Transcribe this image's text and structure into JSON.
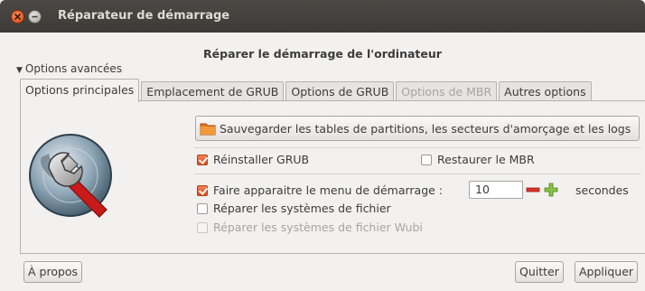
{
  "window": {
    "title": "Réparateur de démarrage"
  },
  "heading": "Réparer le démarrage de l'ordinateur",
  "expander": {
    "label": "Options avancées"
  },
  "tabs": [
    {
      "label": "Options principales",
      "state": "active"
    },
    {
      "label": "Emplacement de GRUB",
      "state": "normal"
    },
    {
      "label": "Options de GRUB",
      "state": "normal"
    },
    {
      "label": "Options de MBR",
      "state": "disabled"
    },
    {
      "label": "Autres options",
      "state": "normal"
    }
  ],
  "main": {
    "backup_button": "Sauvegarder les tables de partitions, les secteurs d'amorçage et les logs",
    "reinstall_grub": {
      "label": "Réinstaller GRUB",
      "checked": true
    },
    "restore_mbr": {
      "label": "Restaurer le MBR",
      "checked": false
    },
    "show_menu": {
      "label": "Faire apparaitre le menu de démarrage :",
      "checked": true
    },
    "menu_timeout": {
      "value": "10",
      "unit": "secondes"
    },
    "repair_fs": {
      "label": "Réparer les systèmes de fichier",
      "checked": false
    },
    "repair_wubi": {
      "label": "Réparer les systèmes de fichier Wubi",
      "checked": false,
      "disabled": true
    }
  },
  "footer": {
    "about": "À propos",
    "quit": "Quitter",
    "apply": "Appliquer"
  },
  "colors": {
    "accent": "#df4b16",
    "titlebar": "#3c3b37",
    "background": "#f2f1f0"
  }
}
